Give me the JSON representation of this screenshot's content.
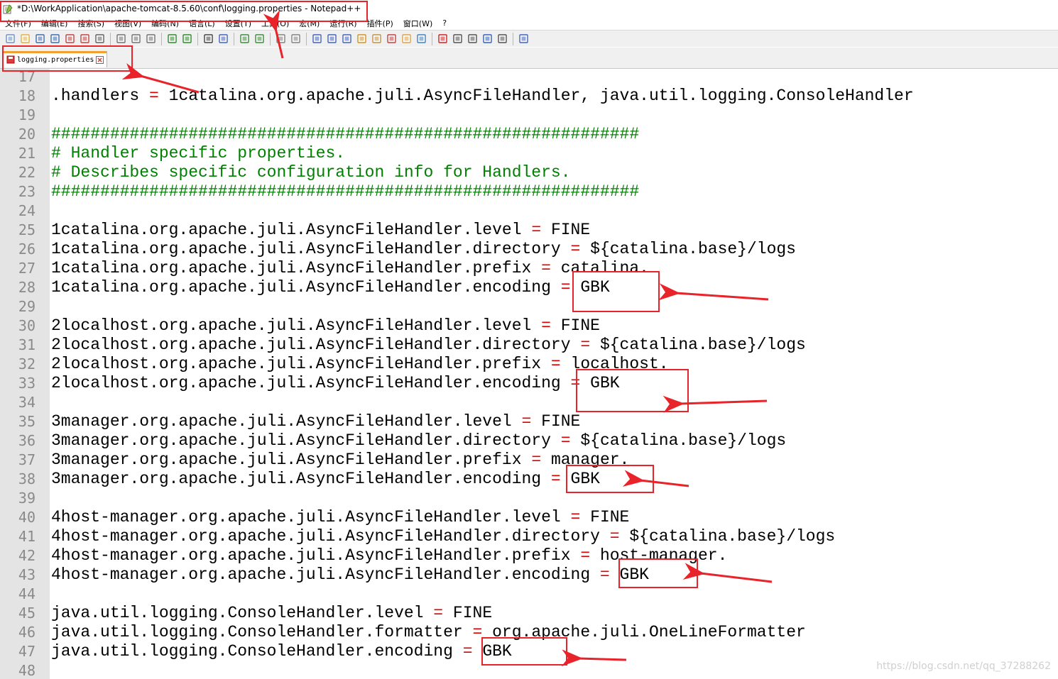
{
  "window": {
    "title": "*D:\\WorkApplication\\apache-tomcat-8.5.60\\conf\\logging.properties - Notepad++"
  },
  "menu": [
    "文件(F)",
    "编辑(E)",
    "搜索(S)",
    "视图(V)",
    "编码(N)",
    "语言(L)",
    "设置(T)",
    "工具(O)",
    "宏(M)",
    "运行(R)",
    "插件(P)",
    "窗口(W)",
    "?"
  ],
  "tab": {
    "label": "logging.properties"
  },
  "lines": [
    {
      "num": "17",
      "text": ""
    },
    {
      "num": "18",
      "key": ".handlers",
      "val": "1catalina.org.apache.juli.AsyncFileHandler, java.util.logging.ConsoleHandler"
    },
    {
      "num": "19",
      "text": ""
    },
    {
      "num": "20",
      "comment": "############################################################"
    },
    {
      "num": "21",
      "comment": "# Handler specific properties."
    },
    {
      "num": "22",
      "comment": "# Describes specific configuration info for Handlers."
    },
    {
      "num": "23",
      "comment": "############################################################"
    },
    {
      "num": "24",
      "text": ""
    },
    {
      "num": "25",
      "key": "1catalina.org.apache.juli.AsyncFileHandler.level",
      "val": "FINE"
    },
    {
      "num": "26",
      "key": "1catalina.org.apache.juli.AsyncFileHandler.directory",
      "val": "${catalina.base}/logs"
    },
    {
      "num": "27",
      "key": "1catalina.org.apache.juli.AsyncFileHandler.prefix",
      "val": "catalina."
    },
    {
      "num": "28",
      "key": "1catalina.org.apache.juli.AsyncFileHandler.encoding",
      "val": "GBK"
    },
    {
      "num": "29",
      "text": ""
    },
    {
      "num": "30",
      "key": "2localhost.org.apache.juli.AsyncFileHandler.level",
      "val": "FINE"
    },
    {
      "num": "31",
      "key": "2localhost.org.apache.juli.AsyncFileHandler.directory",
      "val": "${catalina.base}/logs"
    },
    {
      "num": "32",
      "key": "2localhost.org.apache.juli.AsyncFileHandler.prefix",
      "val": "localhost."
    },
    {
      "num": "33",
      "key": "2localhost.org.apache.juli.AsyncFileHandler.encoding",
      "val": "GBK"
    },
    {
      "num": "34",
      "text": ""
    },
    {
      "num": "35",
      "key": "3manager.org.apache.juli.AsyncFileHandler.level",
      "val": "FINE"
    },
    {
      "num": "36",
      "key": "3manager.org.apache.juli.AsyncFileHandler.directory",
      "val": "${catalina.base}/logs"
    },
    {
      "num": "37",
      "key": "3manager.org.apache.juli.AsyncFileHandler.prefix",
      "val": "manager."
    },
    {
      "num": "38",
      "key": "3manager.org.apache.juli.AsyncFileHandler.encoding",
      "val": "GBK"
    },
    {
      "num": "39",
      "text": ""
    },
    {
      "num": "40",
      "key": "4host-manager.org.apache.juli.AsyncFileHandler.level",
      "val": "FINE"
    },
    {
      "num": "41",
      "key": "4host-manager.org.apache.juli.AsyncFileHandler.directory",
      "val": "${catalina.base}/logs"
    },
    {
      "num": "42",
      "key": "4host-manager.org.apache.juli.AsyncFileHandler.prefix",
      "val": "host-manager."
    },
    {
      "num": "43",
      "key": "4host-manager.org.apache.juli.AsyncFileHandler.encoding",
      "val": "GBK"
    },
    {
      "num": "44",
      "text": ""
    },
    {
      "num": "45",
      "key": "java.util.logging.ConsoleHandler.level",
      "val": "FINE"
    },
    {
      "num": "46",
      "key": "java.util.logging.ConsoleHandler.formatter",
      "val": "org.apache.juli.OneLineFormatter"
    },
    {
      "num": "47",
      "key": "java.util.logging.ConsoleHandler.encoding",
      "val": "GBK"
    },
    {
      "num": "48",
      "text": ""
    }
  ],
  "watermark": "https://blog.csdn.net/qq_37288262",
  "colors": {
    "annotation": "#e8232a",
    "operator": "#e00000",
    "comment": "#008000",
    "line_number": "#8a8a8a"
  },
  "toolbar_icons": [
    "new-file-icon",
    "open-file-icon",
    "save-icon",
    "save-all-icon",
    "close-icon",
    "close-all-icon",
    "print-icon",
    "cut-icon",
    "copy-icon",
    "paste-icon",
    "undo-icon",
    "redo-icon",
    "find-icon",
    "replace-icon",
    "zoom-in-icon",
    "zoom-out-icon",
    "sync-v-icon",
    "sync-h-icon",
    "word-wrap-icon",
    "show-all-chars-icon",
    "indent-guide-icon",
    "udl-icon",
    "doc-map-icon",
    "function-list-icon",
    "folder-workspace-icon",
    "monitor-icon",
    "record-macro-icon",
    "stop-macro-icon",
    "play-macro-icon",
    "run-macro-multiple-icon",
    "save-macro-icon",
    "spellcheck-icon"
  ]
}
